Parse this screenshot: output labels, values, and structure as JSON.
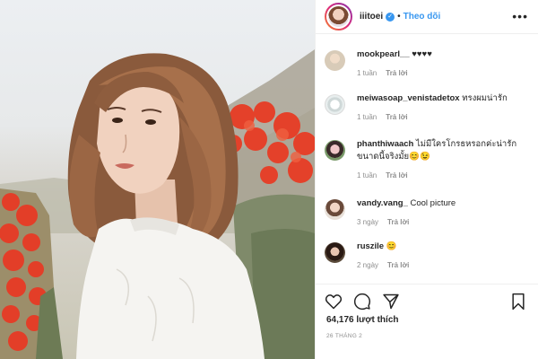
{
  "post": {
    "username": "iiitoei",
    "separator": "•",
    "follow_label": "Theo dõi",
    "more_icon": "more-horizontal-icon"
  },
  "comments": [
    {
      "user": "mookpearl__",
      "text": "♥♥♥♥",
      "time": "1 tuần",
      "reply": "Trả lời"
    },
    {
      "user": "meiwasoap_venistadetox",
      "text": "ทรงผมน่ารัก",
      "time": "1 tuần",
      "reply": "Trả lời"
    },
    {
      "user": "phanthiwaach",
      "text": "ไม่มีใครโกรธหรอกค่ะน่ารักขนาดนี้จริงมั้ย😊😉",
      "time": "1 tuần",
      "reply": "Trả lời"
    },
    {
      "user": "vandy.vang_",
      "text": "Cool picture",
      "time": "3 ngày",
      "reply": "Trả lời"
    },
    {
      "user": "ruszile",
      "text": "😊",
      "time": "2 ngày",
      "reply": "Trả lời"
    }
  ],
  "actions": {
    "icons": [
      "heart-icon",
      "comment-icon",
      "share-icon",
      "bookmark-icon"
    ],
    "likes": "64,176 lượt thích",
    "date": "26 THÁNG 2"
  },
  "colors": {
    "accent": "#3897f0",
    "text": "#262626",
    "muted": "#8e8e8e",
    "border": "#efefef"
  }
}
